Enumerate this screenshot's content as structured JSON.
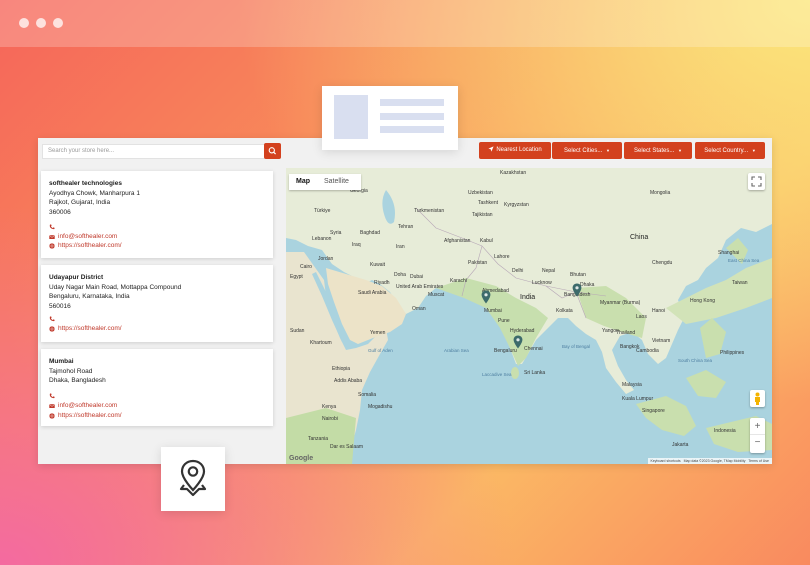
{
  "search": {
    "placeholder": "Search your store here..."
  },
  "buttons": {
    "nearest": "Nearest Location",
    "cities": "Select Cities...",
    "states": "Select States...",
    "country": "Select Country..."
  },
  "stores": [
    {
      "name": "softhealer technologies",
      "address1": "Ayodhya Chowk, Manharpura 1",
      "address2": "Rajkot, Gujarat, India",
      "zip": "360006",
      "email": "info@softhealer.com",
      "website": "https://softhealer.com/"
    },
    {
      "name": "Udayapur District",
      "address1": "Uday Nagar Main Road, Mottappa Compound",
      "address2": "Bengaluru, Karnataka, India",
      "zip": "560016",
      "website": "https://softhealer.com/"
    },
    {
      "name": "Mumbai",
      "address1": "Tajmohol Road",
      "address2": "Dhaka, Bangladesh",
      "email": "info@softhealer.com",
      "website": "https://softhealer.com/"
    }
  ],
  "map": {
    "tab_map": "Map",
    "tab_satellite": "Satellite",
    "zoom_in": "+",
    "zoom_out": "−",
    "google": "Google",
    "attribution_shortcuts": "Keyboard shortcuts",
    "attribution_data": "Map data ©2023 Google, TMap Mobility",
    "attribution_terms": "Terms of Use",
    "labels": {
      "kazakhstan": "Kazakhstan",
      "uzbekistan": "Uzbekistan",
      "kyrgyzstan": "Kyrgyzstan",
      "georgia": "Georgia",
      "turkmenistan": "Turkmenistan",
      "tajikistan": "Tajikistan",
      "turkiye": "Türkiye",
      "syria": "Syria",
      "iraq": "Iraq",
      "iran": "Iran",
      "lebanon": "Lebanon",
      "jordan": "Jordan",
      "afghanistan": "Afghanistan",
      "pakistan": "Pakistan",
      "egypt": "Egypt",
      "kuwait": "Kuwait",
      "saudi_arabia": "Saudi Arabia",
      "uae": "United Arab Emirates",
      "oman": "Oman",
      "yemen": "Yemen",
      "sudan": "Sudan",
      "ethiopia": "Ethiopia",
      "somalia": "Somalia",
      "kenya": "Kenya",
      "tanzania": "Tanzania",
      "india": "India",
      "nepal": "Nepal",
      "bhutan": "Bhutan",
      "bangladesh": "Bangladesh",
      "myanmar": "Myanmar (Burma)",
      "thailand": "Thailand",
      "laos": "Laos",
      "vietnam": "Vietnam",
      "cambodia": "Cambodia",
      "malaysia": "Malaysia",
      "indonesia": "Indonesia",
      "philippines": "Philippines",
      "china": "China",
      "mongolia": "Mongolia",
      "sri_lanka": "Sri Lanka",
      "arabian_sea": "Arabian Sea",
      "bay_of_bengal": "Bay of Bengal",
      "south_china_sea": "South China Sea",
      "east_china_sea": "East China Sea",
      "taiwan": "Taiwan",
      "hong_kong": "Hong Kong",
      "mumbai": "Mumbai",
      "chennai": "Chennai",
      "bengaluru": "Bengaluru",
      "hyderabad": "Hyderabad",
      "pune": "Pune",
      "ahmedabad": "Ahmedabad",
      "delhi": "Delhi",
      "lucknow": "Lucknow",
      "kolkata": "Kolkata",
      "dhaka": "Dhaka",
      "karachi": "Karachi",
      "lahore": "Lahore",
      "tehran": "Tehran",
      "baghdad": "Baghdad",
      "riyadh": "Riyadh",
      "dubai": "Dubai",
      "muscat": "Muscat",
      "doha": "Doha",
      "kabul": "Kabul",
      "tashkent": "Tashkent",
      "cairo": "Cairo",
      "khartoum": "Khartoum",
      "addis_ababa": "Addis Ababa",
      "mogadishu": "Mogadishu",
      "nairobi": "Nairobi",
      "dar_es_salaam": "Dar es Salaam",
      "bangkok": "Bangkok",
      "hanoi": "Hanoi",
      "yangon": "Yangon",
      "kuala_lumpur": "Kuala Lumpur",
      "singapore": "Singapore",
      "jakarta": "Jakarta",
      "chengdu": "Chengdu",
      "shanghai": "Shanghai",
      "gulf_of_aden": "Gulf of Aden",
      "laccadive_sea": "Laccadive Sea"
    }
  }
}
